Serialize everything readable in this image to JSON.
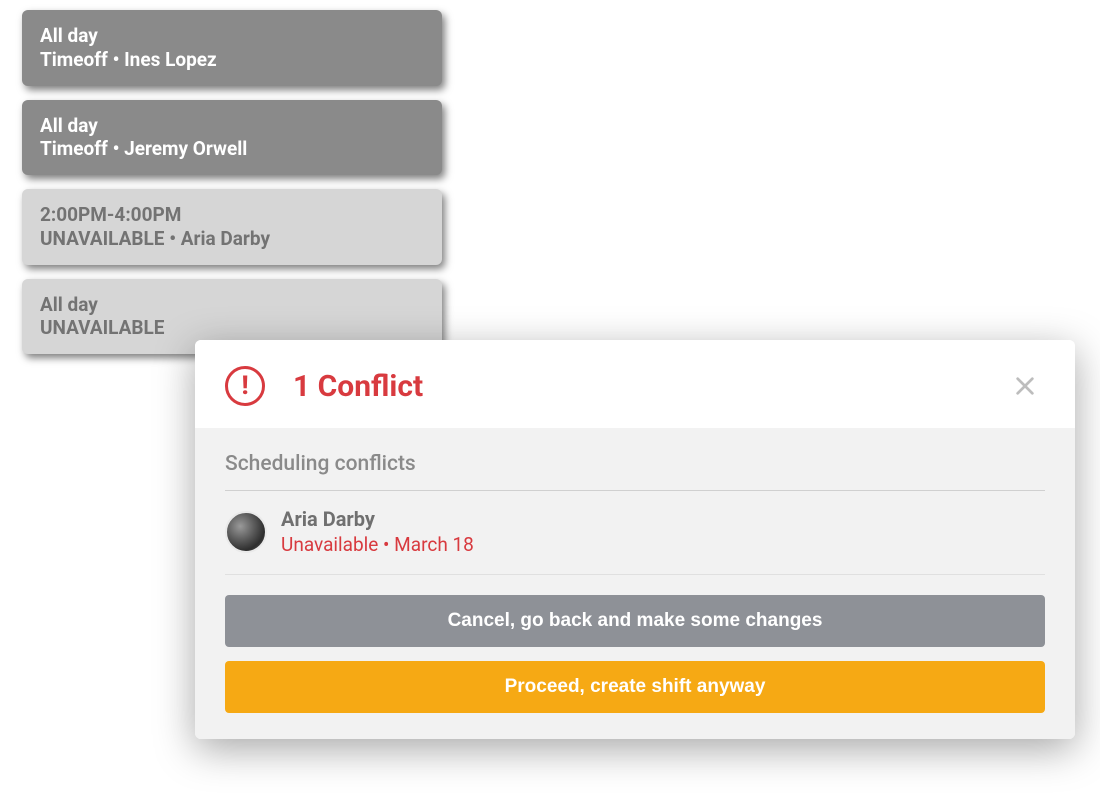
{
  "cards": [
    {
      "variant": "dark",
      "time": "All day",
      "sub": "Timeoff • Ines Lopez"
    },
    {
      "variant": "dark",
      "time": "All day",
      "sub": "Timeoff • Jeremy Orwell"
    },
    {
      "variant": "light",
      "time": "2:00PM-4:00PM",
      "sub": "UNAVAILABLE • Aria Darby"
    },
    {
      "variant": "light",
      "time": "All day",
      "sub": "UNAVAILABLE"
    }
  ],
  "modal": {
    "title": "1 Conflict",
    "section_title": "Scheduling conflicts",
    "conflicts": [
      {
        "name": "Aria Darby",
        "detail": "Unavailable • March 18"
      }
    ],
    "cancel_label": "Cancel, go back and make some changes",
    "proceed_label": "Proceed, create shift anyway"
  },
  "colors": {
    "accent_red": "#d83a3f",
    "accent_orange": "#f6a914",
    "card_dark": "#8a8a8a",
    "card_light": "#d6d6d6"
  }
}
